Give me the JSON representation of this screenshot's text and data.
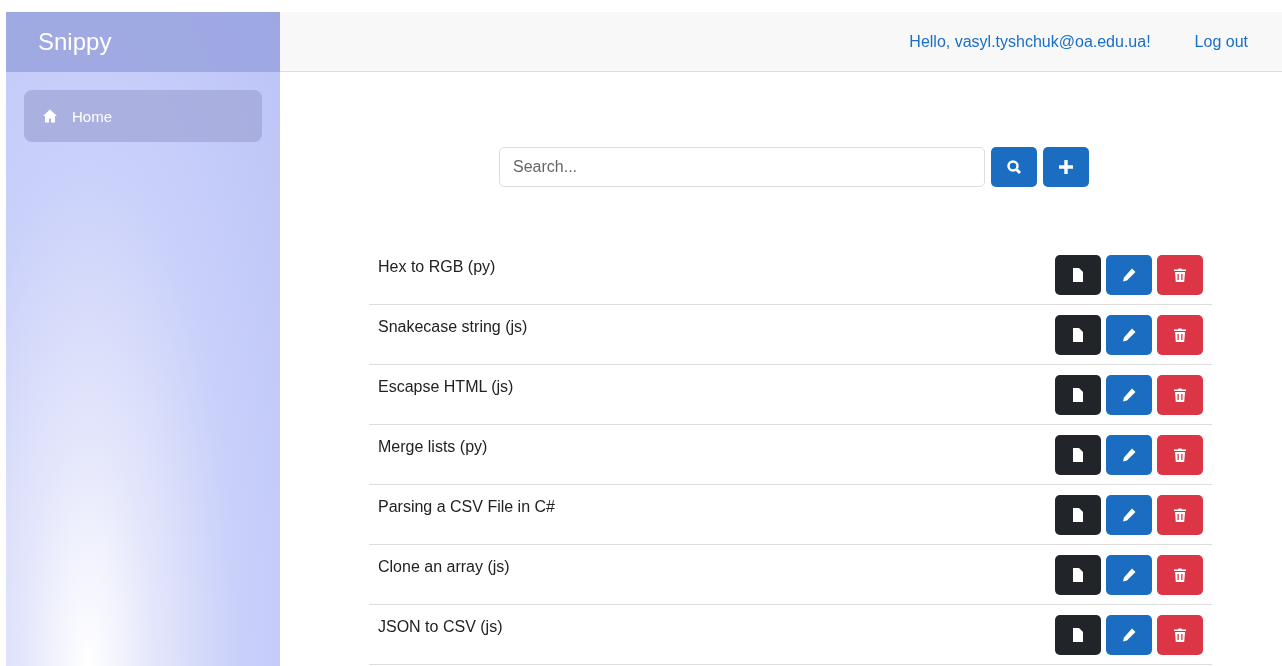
{
  "sidebar": {
    "brand": "Snippy",
    "items": [
      {
        "label": "Home",
        "selected": true
      }
    ]
  },
  "header": {
    "greeting": "Hello, vasyl.tyshchuk@oa.edu.ua!",
    "logout": "Log out"
  },
  "search": {
    "placeholder": "Search..."
  },
  "snippets": [
    {
      "title": "Hex to RGB (py)"
    },
    {
      "title": "Snakecase string (js)"
    },
    {
      "title": "Escapse HTML (js)"
    },
    {
      "title": "Merge lists (py)"
    },
    {
      "title": "Parsing a CSV File in C#"
    },
    {
      "title": "Clone an array (js)"
    },
    {
      "title": "JSON to CSV (js)"
    }
  ]
}
